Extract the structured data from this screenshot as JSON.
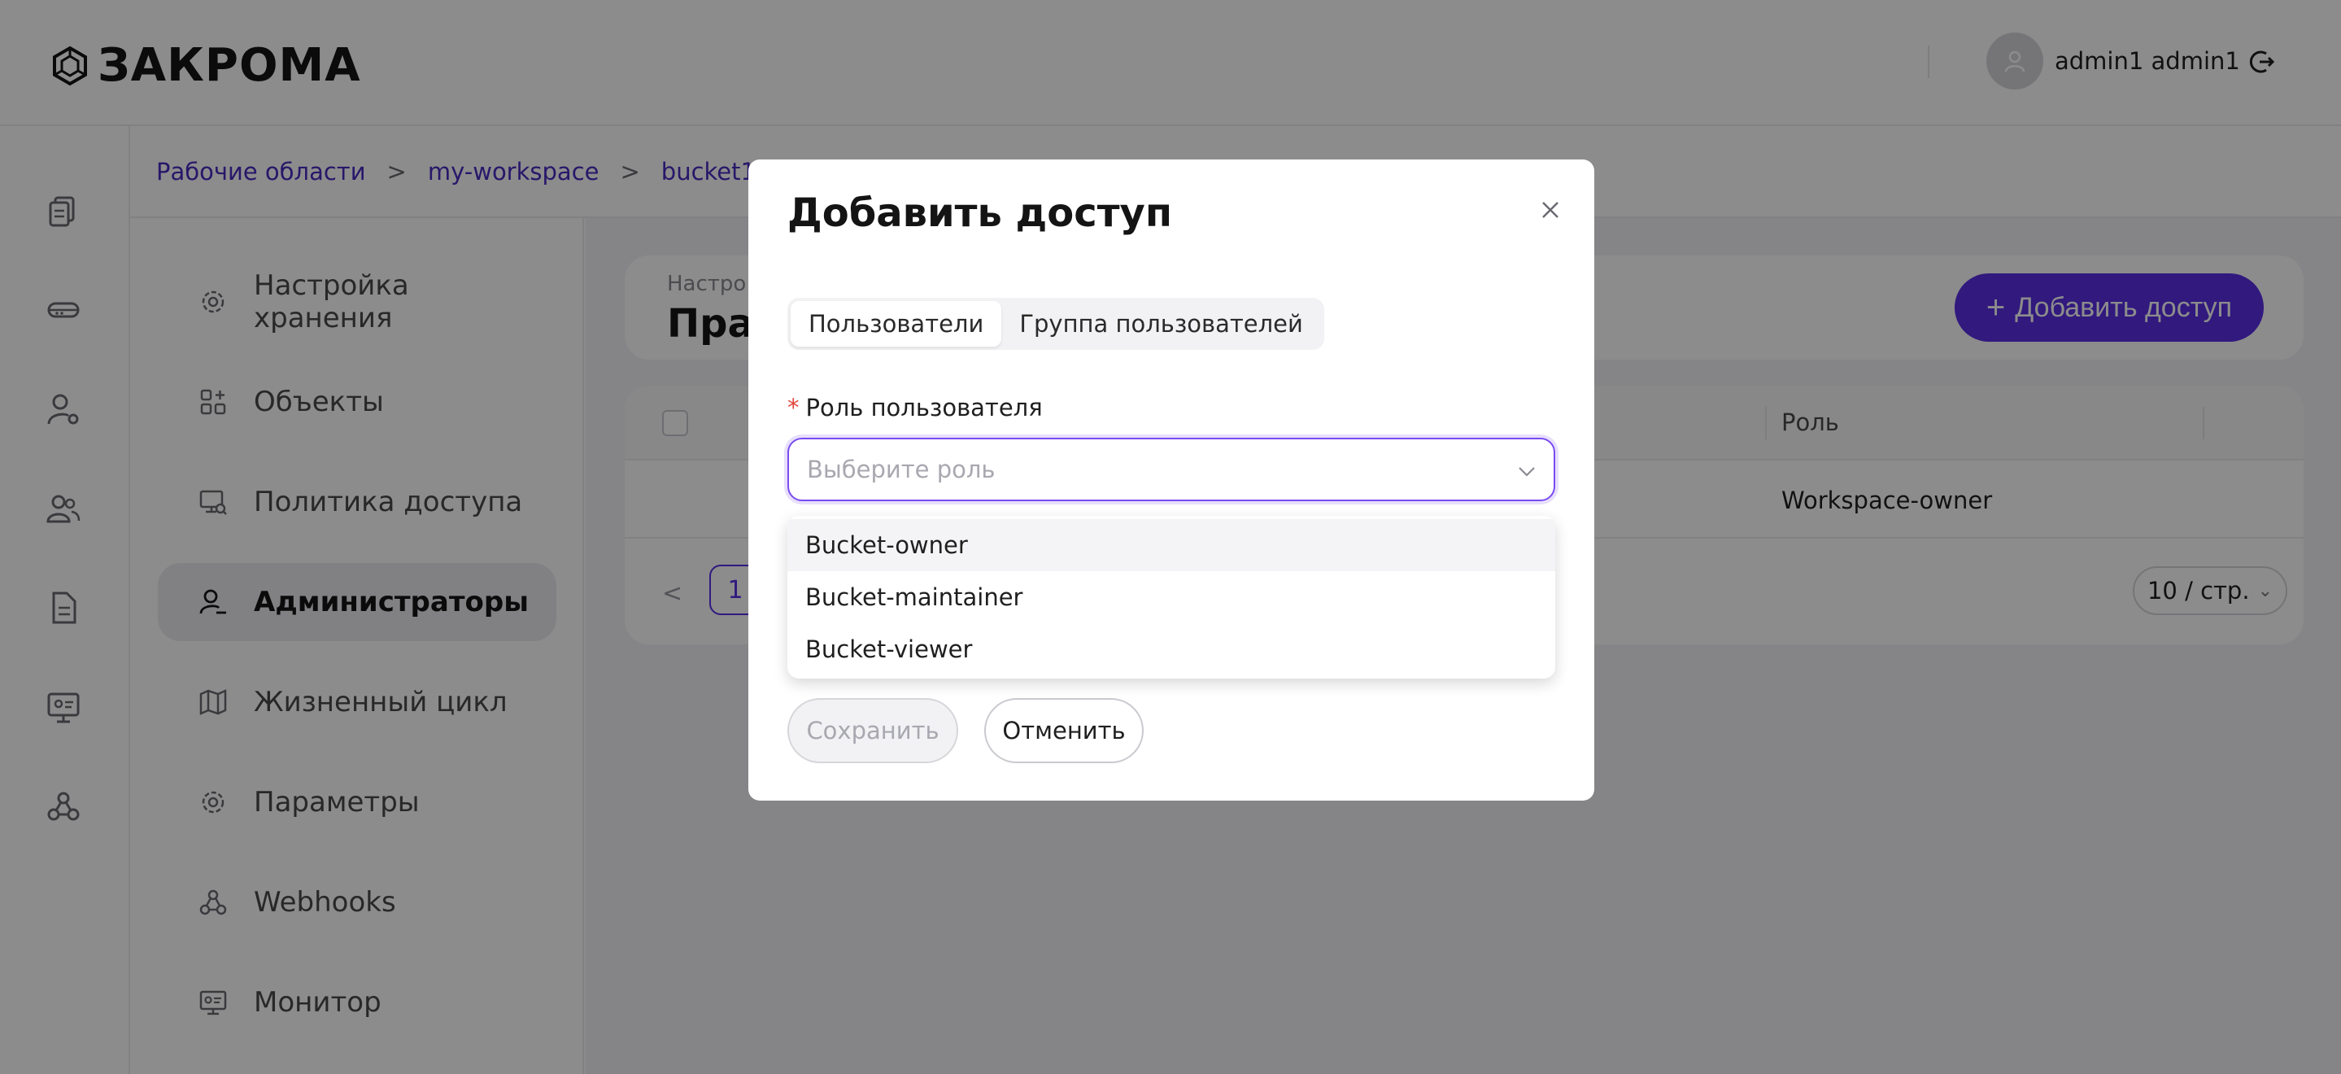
{
  "header": {
    "logo_text": "ЗАКРОМА",
    "user_name": "admin1 admin1"
  },
  "rail": {
    "icons": [
      "documents-icon",
      "storage-drive-icon",
      "user-settings-icon",
      "users-icon",
      "file-icon",
      "monitor-icon",
      "webhooks-icon"
    ]
  },
  "breadcrumb": {
    "items": [
      "Рабочие области",
      "my-workspace",
      "bucket1"
    ],
    "separator": ">"
  },
  "side_menu": {
    "items": [
      {
        "label": "Настройка хранения",
        "icon": "gear-icon"
      },
      {
        "label": "Объекты",
        "icon": "objects-grid-icon"
      },
      {
        "label": "Политика доступа",
        "icon": "access-policy-icon"
      },
      {
        "label": "Администраторы",
        "icon": "admin-user-icon",
        "active": true
      },
      {
        "label": "Жизненный цикл",
        "icon": "map-icon"
      },
      {
        "label": "Параметры",
        "icon": "gear-icon"
      },
      {
        "label": "Webhooks",
        "icon": "webhooks-icon"
      },
      {
        "label": "Монитор",
        "icon": "monitor-icon"
      }
    ]
  },
  "main": {
    "title_sub": "Настро",
    "title": "Пра",
    "add_button_label": "Добавить доступ",
    "table": {
      "role_header": "Роль",
      "rows": [
        {
          "role": "Workspace-owner"
        }
      ]
    },
    "pagination": {
      "current_page": "1",
      "page_size": "10 / стр."
    }
  },
  "modal": {
    "title": "Добавить доступ",
    "tabs": [
      "Пользователи",
      "Группа пользователей"
    ],
    "active_tab": 0,
    "field_label": "Роль пользователя",
    "required_mark": "*",
    "select_placeholder": "Выберите роль",
    "options": [
      "Bucket-owner",
      "Bucket-maintainer",
      "Bucket-viewer"
    ],
    "save_label": "Сохранить",
    "cancel_label": "Отменить"
  },
  "colors": {
    "accent": "#5a2ee6",
    "link": "#4a2bc2",
    "required": "#e0463a"
  }
}
